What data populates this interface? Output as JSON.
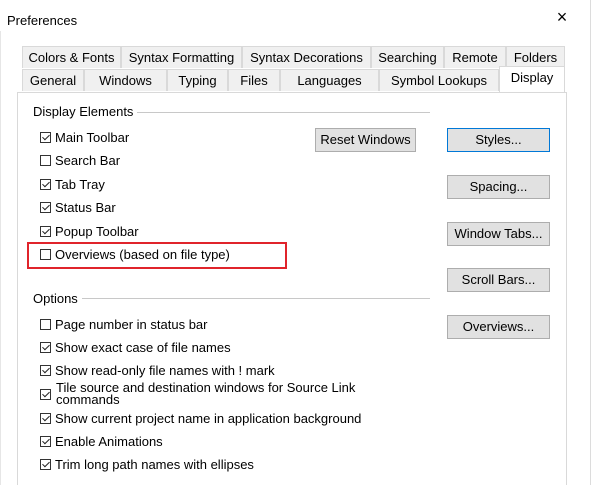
{
  "window": {
    "title": "Preferences"
  },
  "tabs_row1": [
    {
      "label": "Colors & Fonts"
    },
    {
      "label": "Syntax Formatting"
    },
    {
      "label": "Syntax Decorations"
    },
    {
      "label": "Searching"
    },
    {
      "label": "Remote"
    },
    {
      "label": "Folders"
    }
  ],
  "tabs_row2": [
    {
      "label": "General"
    },
    {
      "label": "Windows"
    },
    {
      "label": "Typing"
    },
    {
      "label": "Files"
    },
    {
      "label": "Languages"
    },
    {
      "label": "Symbol Lookups"
    },
    {
      "label": "Display"
    }
  ],
  "display_elements": {
    "heading": "Display Elements",
    "items": [
      {
        "label": "Main Toolbar",
        "checked": true
      },
      {
        "label": "Search Bar",
        "checked": false
      },
      {
        "label": "Tab Tray",
        "checked": true
      },
      {
        "label": "Status Bar",
        "checked": true
      },
      {
        "label": "Popup Toolbar",
        "checked": true
      },
      {
        "label": "Overviews (based on file type)",
        "checked": false
      }
    ],
    "reset_button": "Reset Windows"
  },
  "options": {
    "heading": "Options",
    "items": [
      {
        "label": "Page number in status bar",
        "checked": false
      },
      {
        "label": "Show exact case of file names",
        "checked": true
      },
      {
        "label": "Show read-only file names with ! mark",
        "checked": true
      },
      {
        "label": "Tile source and destination windows for Source Link commands",
        "checked": true
      },
      {
        "label": "Show current project name in application background",
        "checked": true
      },
      {
        "label": "Enable Animations",
        "checked": true
      },
      {
        "label": "Trim long path names with ellipses",
        "checked": true
      }
    ]
  },
  "side_buttons": [
    {
      "label": "Styles..."
    },
    {
      "label": "Spacing..."
    },
    {
      "label": "Window Tabs..."
    },
    {
      "label": "Scroll Bars..."
    },
    {
      "label": "Overviews..."
    }
  ]
}
